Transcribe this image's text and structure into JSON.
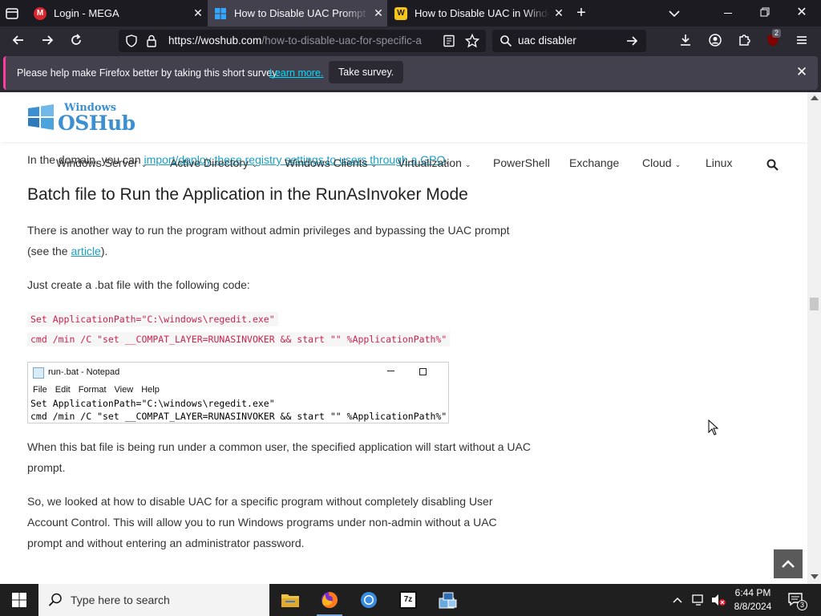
{
  "browser": {
    "tabs": [
      {
        "title": "Login - MEGA",
        "icon": "mega-icon"
      },
      {
        "title": "How to Disable UAC Prompt for",
        "icon": "windows-icon",
        "active": true
      },
      {
        "title": "How to Disable UAC in Window",
        "icon": "w-icon"
      }
    ],
    "url_host": "https://woshub.com",
    "url_path": "/how-to-disable-uac-for-specific-a",
    "search_value": "uac disabler",
    "extension_badge": "2"
  },
  "notification": {
    "message": "Please help make Firefox better by taking this short survey.",
    "learn_more": "Learn more.",
    "take_survey": "Take survey."
  },
  "site": {
    "logo_top": "Windows",
    "logo_bottom": "OSHub",
    "nav": [
      "Windows Server",
      "Active Directory",
      "Windows Clients",
      "Virtualization",
      "PowerShell",
      "Exchange",
      "Cloud",
      "Linux"
    ]
  },
  "article": {
    "overlap_prefix": "In the domain, you can ",
    "overlap_link": "import/deploy these registry settings to users through a GPO",
    "overlap_suffix": ".",
    "heading": "Batch file to Run the Application in the RunAsInvoker Mode",
    "p1_text": "There is another way to run the program without admin privileges and bypassing the UAC prompt",
    "p1_line2_prefix": "(see the ",
    "p1_link": "article",
    "p1_line2_suffix": ").",
    "p2": "Just create a .bat file with the following code:",
    "code1": "Set ApplicationPath=\"C:\\windows\\regedit.exe\"",
    "code2": "cmd /min /C \"set __COMPAT_LAYER=RUNASINVOKER && start \"\" %ApplicationPath%\"",
    "p3_line1": "When this bat file is being run under a common user, the specified application will start without a UAC",
    "p3_line2": "prompt.",
    "p4_line1": "So, we looked at how to disable UAC for a specific program without completely disabling User",
    "p4_line2": "Account Control. This will allow you to run Windows programs under non-admin without a UAC",
    "p4_line3": "prompt and without entering an administrator password."
  },
  "notepad": {
    "title": "run-.bat - Notepad",
    "menu": [
      "File",
      "Edit",
      "Format",
      "View",
      "Help"
    ],
    "line1": "Set ApplicationPath=\"C:\\windows\\regedit.exe\"",
    "line2": "cmd /min /C \"set __COMPAT_LAYER=RUNASINVOKER && start \"\" %ApplicationPath%\""
  },
  "taskbar": {
    "search_placeholder": "Type here to search",
    "time": "6:44 PM",
    "date": "8/8/2024",
    "notification_count": "3",
    "app_7z_label": "7z"
  },
  "colors": {
    "accent_link": "#1a9fc4",
    "code_text": "#c7254e",
    "notification_stripe": "#ff3d9e"
  }
}
